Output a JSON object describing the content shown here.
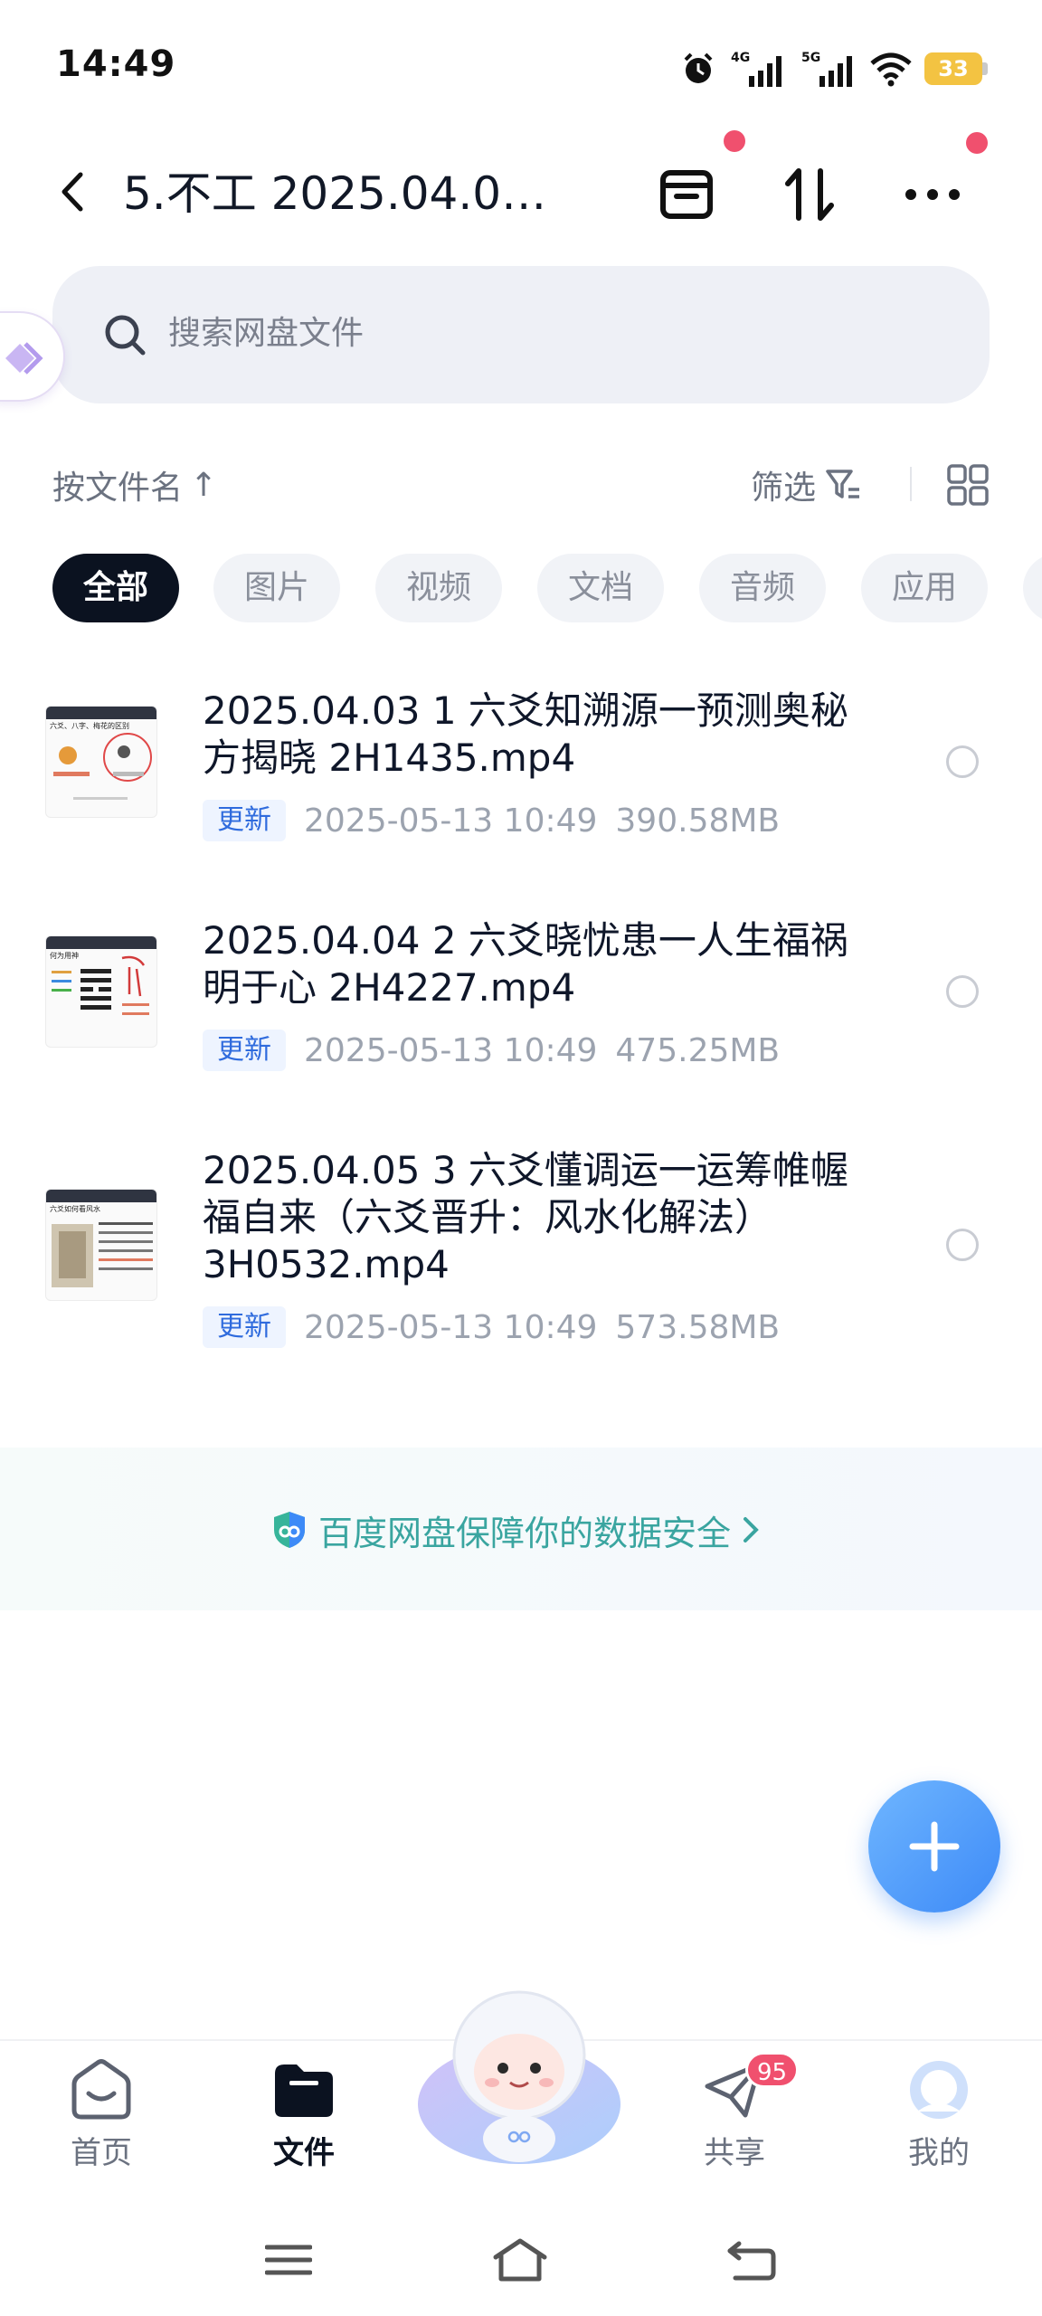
{
  "status_bar": {
    "time": "14:49",
    "network_1": "4G",
    "network_2": "5G",
    "battery": "33",
    "battery_color": "#f3c342"
  },
  "header": {
    "title": "5.不工  2025.04.0…",
    "back_icon": "chevron-left-icon",
    "actions": [
      "archive-icon",
      "sort-transfer-icon",
      "more-icon"
    ]
  },
  "search": {
    "placeholder": "搜索网盘文件"
  },
  "toolbar": {
    "sort_label": "按文件名",
    "sort_arrow": "↑",
    "filter_label": "筛选"
  },
  "tabs": [
    {
      "label": "全部",
      "active": true
    },
    {
      "label": "图片",
      "active": false
    },
    {
      "label": "视频",
      "active": false
    },
    {
      "label": "文档",
      "active": false
    },
    {
      "label": "音频",
      "active": false
    },
    {
      "label": "应用",
      "active": false
    }
  ],
  "files": [
    {
      "name": "2025.04.03  1  六爻知溯源一预测奥秘方揭晓  2H1435.mp4",
      "badge": "更新",
      "date": "2025-05-13  10:49",
      "size": "390.58MB",
      "thumb_title": "六爻、八字、梅花的区别"
    },
    {
      "name": "2025.04.04  2  六爻晓忧患一人生福祸明于心  2H4227.mp4",
      "badge": "更新",
      "date": "2025-05-13  10:49",
      "size": "475.25MB",
      "thumb_title": "何为用神"
    },
    {
      "name": "2025.04.05  3  六爻懂调运一运筹帷幄福自来（六爻晋升：风水化解法）3H0532.mp4",
      "badge": "更新",
      "date": "2025-05-13  10:49",
      "size": "573.58MB",
      "thumb_title": "六爻如何看风水"
    }
  ],
  "security_banner": {
    "text": "百度网盘保障你的数据安全",
    "color": "#3aa5a0"
  },
  "bottom_nav": {
    "items": [
      {
        "label": "首页",
        "icon": "home-icon"
      },
      {
        "label": "文件",
        "icon": "folder-icon",
        "active": true
      },
      {
        "label": "共享",
        "icon": "send-icon",
        "badge": "95"
      },
      {
        "label": "我的",
        "icon": "profile-icon"
      }
    ]
  },
  "accent_color": "#3d8af7"
}
